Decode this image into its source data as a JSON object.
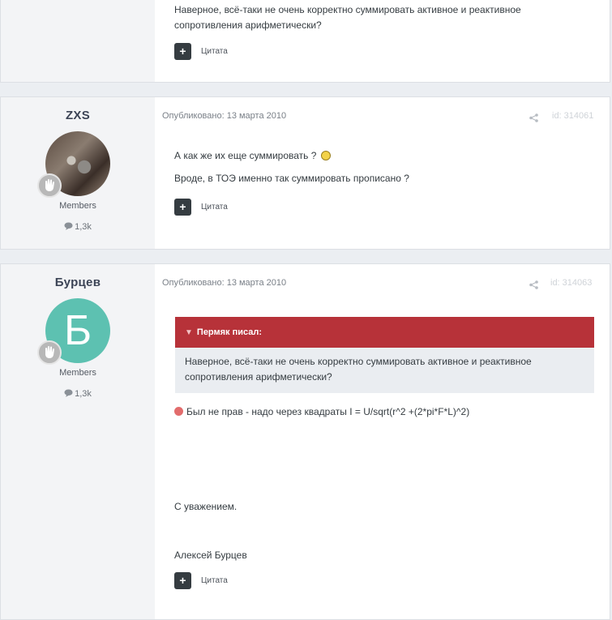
{
  "posts": [
    {
      "body_lines": [
        "Наверное, всё-таки не очень корректно суммировать активное и реактивное",
        "сопротивления арифметически?"
      ],
      "quote_label": "Цитата"
    },
    {
      "author": "ZXS",
      "group": "Members",
      "count": "1,3k",
      "published": "Опубликовано: 13 марта 2010",
      "post_id": "id: 314061",
      "body_lines": [
        "А как же их еще суммировать ?",
        "Вроде, в ТОЭ именно так суммировать прописано ?"
      ],
      "quote_label": "Цитата"
    },
    {
      "author": "Бурцев",
      "avatar_letter": "Б",
      "group": "Members",
      "count": "1,3k",
      "published": "Опубликовано: 13 марта 2010",
      "post_id": "id: 314063",
      "quote_author": "Пермяк писал:",
      "quote_lines": [
        "Наверное, всё-таки не очень корректно суммировать активное и реактивное",
        "сопротивления арифметически?"
      ],
      "body_lines": [
        "Был не прав - надо через квадраты I = U/sqrt(r^2 +(2*pi*F*L)^2)",
        "С уважением.",
        "Алексей Бурцев"
      ],
      "quote_label": "Цитата"
    }
  ],
  "colors": {
    "accent": "#b73239",
    "avatar_bg": "#5dc1b1",
    "author_panel": "#f3f4f6"
  },
  "icons": {
    "reply": "plus-icon",
    "share": "share-icon",
    "count": "comment-icon",
    "rank": "hand-icon"
  }
}
